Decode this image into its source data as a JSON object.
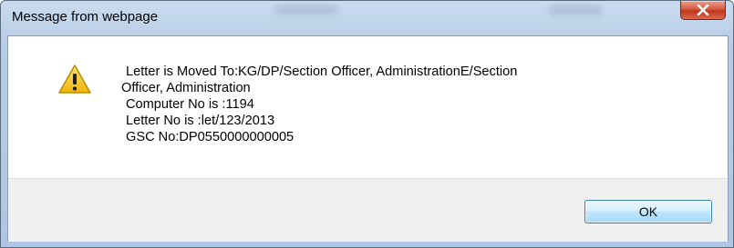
{
  "window": {
    "title": "Message from webpage"
  },
  "dialog": {
    "icon": "warning-icon",
    "message_lines": [
      "Letter is Moved To:KG/DP/Section Officer, AdministrationE/Section",
      "Officer, Administration",
      "Computer No is :1194",
      "Letter No is :let/123/2013",
      "GSC No:DP0550000000005"
    ],
    "ok_label": "OK"
  },
  "colors": {
    "titlebar": "#b7cde6",
    "close_button": "#c2341c",
    "footer": "#f0f0f0",
    "ok_border": "#3c7fb1",
    "warning_fill": "#f5c518"
  }
}
